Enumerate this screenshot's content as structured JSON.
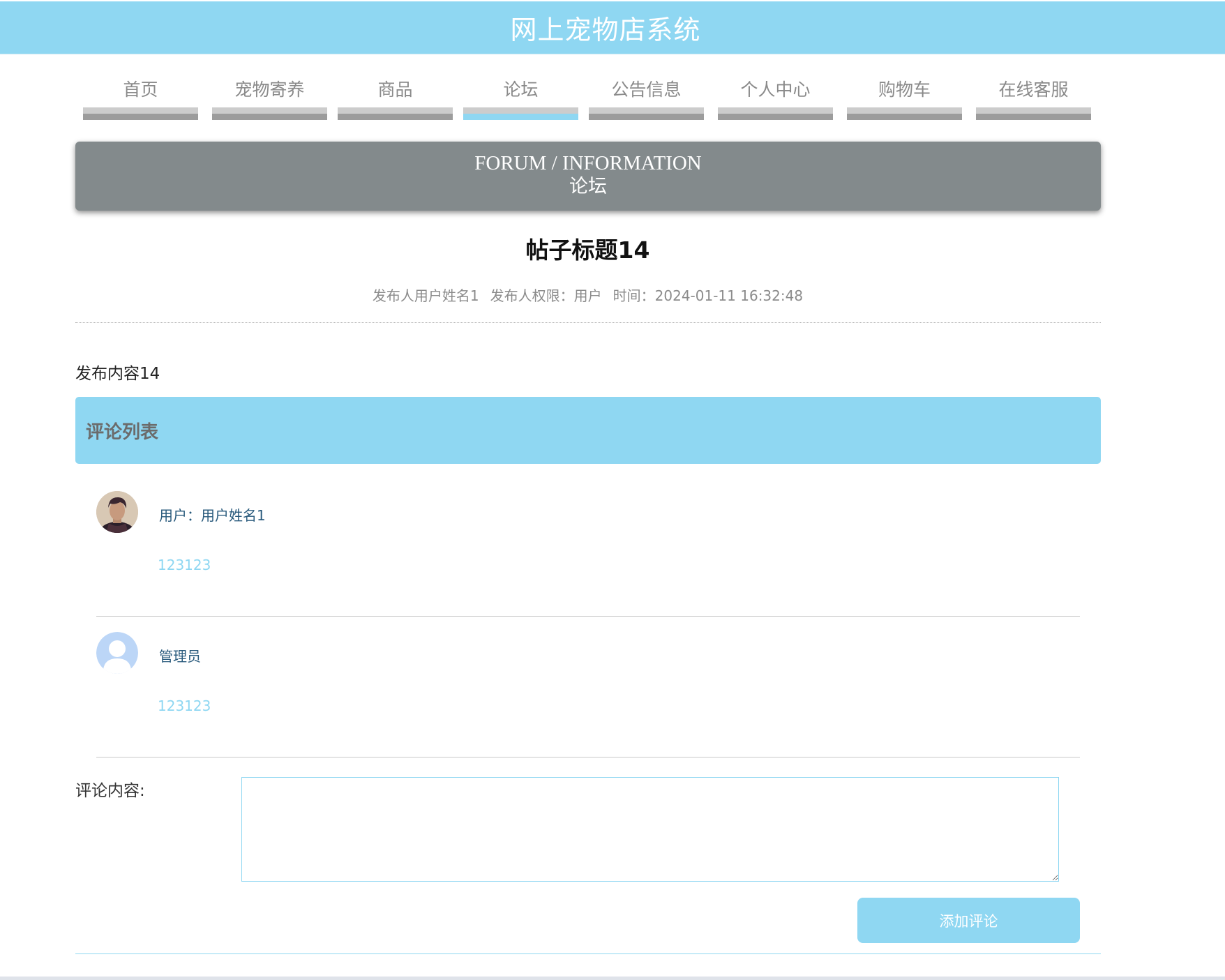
{
  "header": {
    "site_title": "网上宠物店系统"
  },
  "nav": {
    "items": [
      {
        "label": "首页"
      },
      {
        "label": "宠物寄养"
      },
      {
        "label": "商品"
      },
      {
        "label": "论坛",
        "active": true
      },
      {
        "label": "公告信息"
      },
      {
        "label": "个人中心"
      },
      {
        "label": "购物车"
      },
      {
        "label": "在线客服"
      }
    ]
  },
  "banner": {
    "title_en": "FORUM / INFORMATION",
    "title_cn": "论坛"
  },
  "post": {
    "title": "帖子标题14",
    "author": "发布人用户姓名1",
    "role": "发布人权限：用户",
    "time": "时间：2024-01-11 16:32:48",
    "content": "发布内容14"
  },
  "comments": {
    "header": "评论列表",
    "items": [
      {
        "user": "用户：用户姓名1",
        "text": "123123",
        "avatar": "user-photo-avatar"
      },
      {
        "user": "管理员",
        "text": "123123",
        "avatar": "default-person-avatar"
      }
    ]
  },
  "form": {
    "label": "评论内容:",
    "placeholder": "",
    "submit_label": "添加评论"
  },
  "colors": {
    "accent": "#8fd7f2",
    "banner_bg": "#838a8c",
    "nav_bar": "#9c9c9c"
  }
}
